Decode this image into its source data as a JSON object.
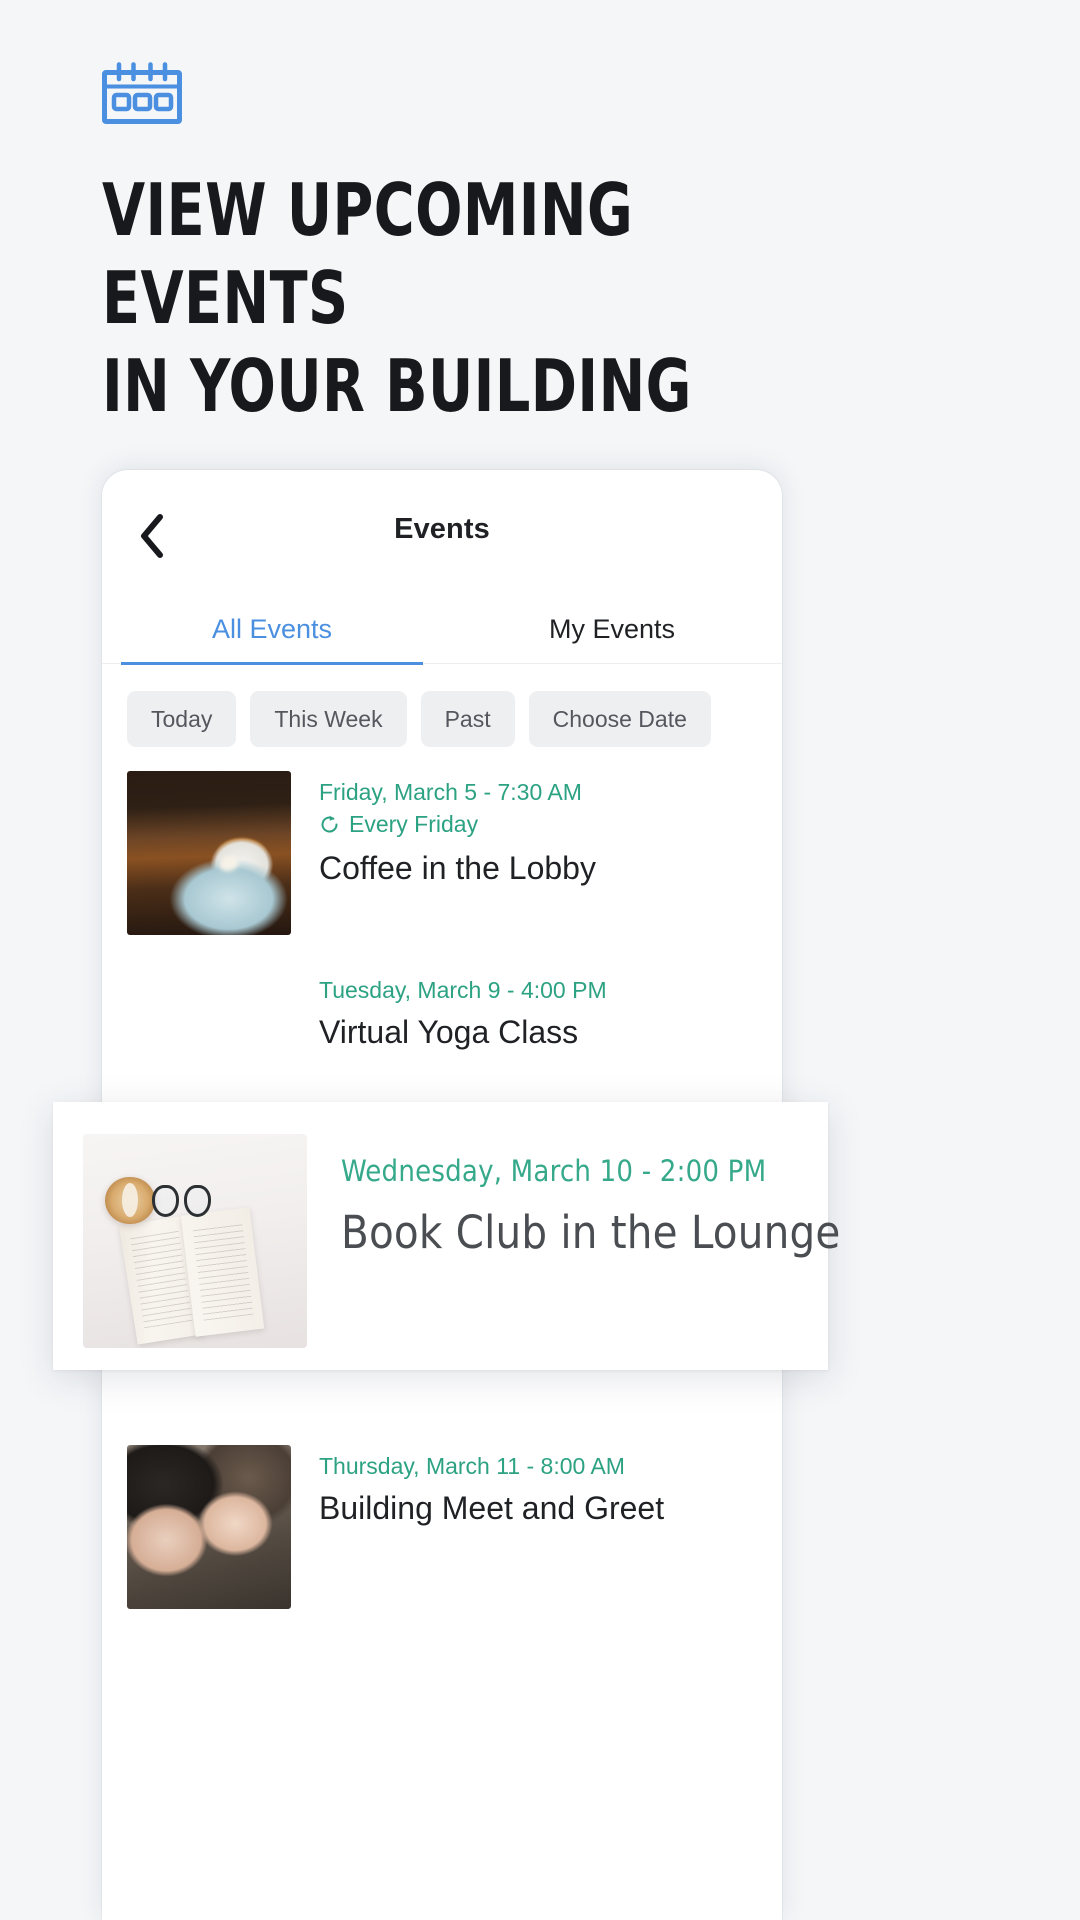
{
  "hero": {
    "icon": "calendar-icon",
    "headline": "VIEW UPCOMING EVENTS\nIN YOUR BUILDING",
    "accent_color": "#4a8fe0"
  },
  "phone": {
    "appbar": {
      "back_icon": "chevron-left-icon",
      "title": "Events"
    },
    "tabs": [
      {
        "label": "All Events",
        "active": true
      },
      {
        "label": "My Events",
        "active": false
      }
    ],
    "filters": [
      {
        "label": "Today"
      },
      {
        "label": "This Week"
      },
      {
        "label": "Past"
      },
      {
        "label": "Choose Date"
      }
    ],
    "events": [
      {
        "date": "Friday, March 5 - 7:30 AM",
        "repeat": "Every Friday",
        "repeat_icon": "repeat-icon",
        "title": "Coffee in the Lobby",
        "thumb": "coffee-cup-photo"
      },
      {
        "date": "Tuesday, March 9 - 4:00 PM",
        "repeat": "",
        "title": "Virtual Yoga Class",
        "thumb": "yoga-mats-photo"
      },
      {
        "date": "Thursday, March 11 - 8:00 AM",
        "repeat": "",
        "title": "Building Meet and Greet",
        "thumb": "people-smiling-photo"
      }
    ]
  },
  "highlight": {
    "date": "Wednesday, March 10 - 2:00 PM",
    "title": "Book Club in the Lounge",
    "thumb": "open-book-latte-glasses-photo",
    "date_color": "#35a98a",
    "title_color": "#4a4d51"
  },
  "colors": {
    "page_bg": "#f4f6f8",
    "accent_blue": "#4a8fe0",
    "accent_green": "#2ca283",
    "chip_bg": "#eeeff1",
    "text_dark": "#1f2124"
  }
}
